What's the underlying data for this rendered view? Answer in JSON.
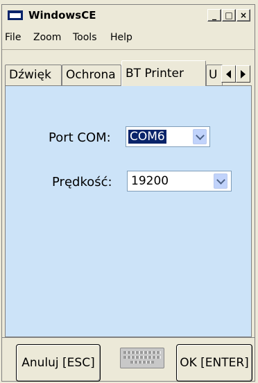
{
  "window": {
    "title": "WindowsCE",
    "minimize_glyph": "_",
    "maximize_glyph": "□",
    "close_glyph": "×"
  },
  "menu": [
    "File",
    "Zoom",
    "Tools",
    "Help"
  ],
  "tabs": [
    {
      "label": "Dźwięk",
      "active": false
    },
    {
      "label": "Ochrona",
      "active": false
    },
    {
      "label": "BT Printer",
      "active": true
    },
    {
      "label": "U",
      "active": false
    }
  ],
  "form": {
    "port_label": "Port COM:",
    "port_value": "COM6",
    "speed_label": "Prędkość:",
    "speed_value": "19200"
  },
  "buttons": {
    "cancel": "Anuluj [ESC]",
    "ok": "OK [ENTER]"
  },
  "icons": {
    "app": "window-icon",
    "keyboard": "keyboard-icon",
    "scroll_left": "arrow-left-icon",
    "scroll_right": "arrow-right-icon",
    "dropdown": "chevron-down-icon"
  },
  "colors": {
    "panel_background": "#cce3f8",
    "selection": "#0a246a"
  }
}
